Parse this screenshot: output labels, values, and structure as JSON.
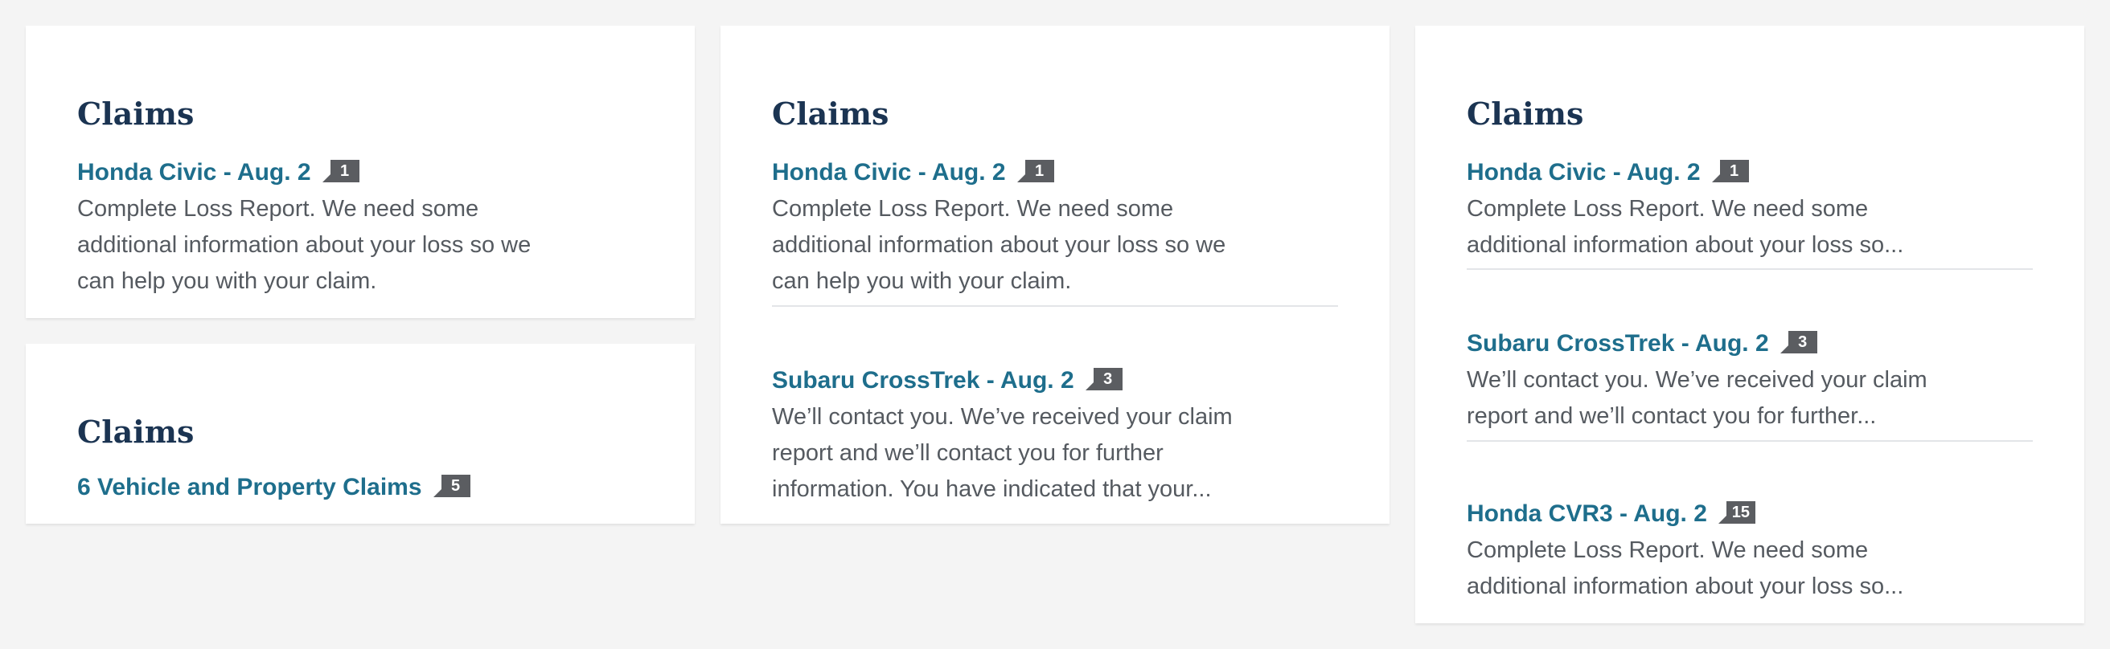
{
  "colors": {
    "background": "#f4f4f4",
    "card": "#ffffff",
    "title": "#1b3452",
    "link": "#1e6e8c",
    "body_text": "#555a60",
    "badge": "#5b5d61",
    "divider": "#e3e5e8"
  },
  "cards": [
    {
      "title": "Claims",
      "claims": [
        {
          "link": "Honda Civic - Aug. 2",
          "count": "1",
          "desc_lines": [
            "Complete Loss Report. We need some",
            "additional information about your loss so we",
            "can help you with your claim."
          ]
        }
      ]
    },
    {
      "title": "Claims",
      "claims": [
        {
          "link": "6 Vehicle and Property Claims",
          "count": "5"
        }
      ]
    },
    {
      "title": "Claims",
      "claims": [
        {
          "link": "Honda Civic - Aug. 2",
          "count": "1",
          "desc_lines": [
            "Complete Loss Report. We need some",
            "additional information about your loss so we",
            "can help you with your claim."
          ]
        },
        {
          "link": "Subaru CrossTrek - Aug. 2",
          "count": "3",
          "desc_lines": [
            "We’ll contact you. We’ve received your claim",
            "report and we’ll contact you for further",
            "information. You have indicated that your..."
          ]
        }
      ]
    },
    {
      "title": "Claims",
      "claims": [
        {
          "link": "Honda Civic - Aug. 2",
          "count": "1",
          "desc_lines": [
            "Complete Loss Report. We need some",
            "additional information about your loss so..."
          ]
        },
        {
          "link": "Subaru CrossTrek - Aug. 2",
          "count": "3",
          "desc_lines": [
            "We’ll contact you. We’ve received your claim",
            "report and we’ll contact you for further..."
          ]
        },
        {
          "link": "Honda CVR3 - Aug. 2",
          "count": "15",
          "desc_lines": [
            "Complete Loss Report. We need some",
            "additional information about your loss so..."
          ]
        }
      ]
    }
  ]
}
